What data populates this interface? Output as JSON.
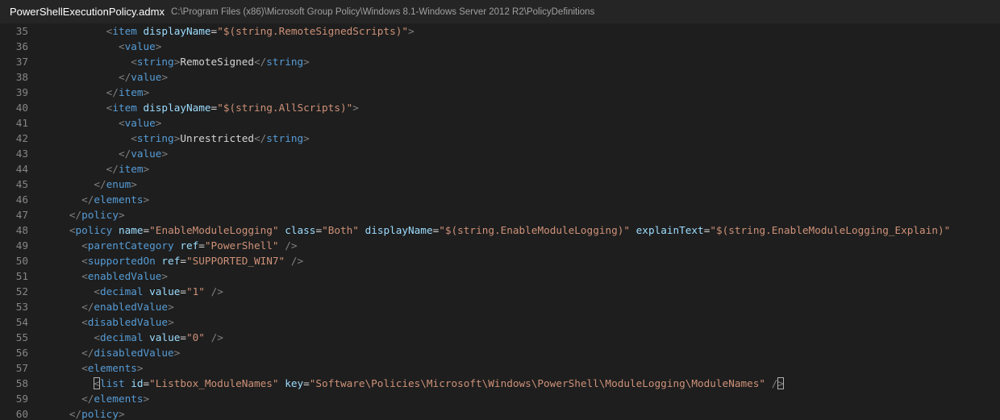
{
  "titlebar": {
    "file_name": "PowerShellExecutionPolicy.admx",
    "file_path": "C:\\Program Files (x86)\\Microsoft Group Policy\\Windows 8.1-Windows Server 2012 R2\\PolicyDefinitions"
  },
  "colors": {
    "background": "#1e1e1e",
    "titlebar": "#252526",
    "line_number": "#858585",
    "punctuation": "#808080",
    "tag": "#569cd6",
    "attribute": "#9cdcfe",
    "string": "#ce9178",
    "text": "#d4d4d4"
  },
  "lines": [
    {
      "n": "35",
      "indent": "            ",
      "tokens": [
        [
          "p",
          "<"
        ],
        [
          "t",
          "item"
        ],
        [
          "x",
          " "
        ],
        [
          "a",
          "displayName"
        ],
        [
          "e",
          "="
        ],
        [
          "s",
          "\"$(string.RemoteSignedScripts)\""
        ],
        [
          "p",
          ">"
        ]
      ]
    },
    {
      "n": "36",
      "indent": "              ",
      "tokens": [
        [
          "p",
          "<"
        ],
        [
          "t",
          "value"
        ],
        [
          "p",
          ">"
        ]
      ]
    },
    {
      "n": "37",
      "indent": "                ",
      "tokens": [
        [
          "p",
          "<"
        ],
        [
          "t",
          "string"
        ],
        [
          "p",
          ">"
        ],
        [
          "x",
          "RemoteSigned"
        ],
        [
          "p",
          "</"
        ],
        [
          "t",
          "string"
        ],
        [
          "p",
          ">"
        ]
      ]
    },
    {
      "n": "38",
      "indent": "              ",
      "tokens": [
        [
          "p",
          "</"
        ],
        [
          "t",
          "value"
        ],
        [
          "p",
          ">"
        ]
      ]
    },
    {
      "n": "39",
      "indent": "            ",
      "tokens": [
        [
          "p",
          "</"
        ],
        [
          "t",
          "item"
        ],
        [
          "p",
          ">"
        ]
      ]
    },
    {
      "n": "40",
      "indent": "            ",
      "tokens": [
        [
          "p",
          "<"
        ],
        [
          "t",
          "item"
        ],
        [
          "x",
          " "
        ],
        [
          "a",
          "displayName"
        ],
        [
          "e",
          "="
        ],
        [
          "s",
          "\"$(string.AllScripts)\""
        ],
        [
          "p",
          ">"
        ]
      ]
    },
    {
      "n": "41",
      "indent": "              ",
      "tokens": [
        [
          "p",
          "<"
        ],
        [
          "t",
          "value"
        ],
        [
          "p",
          ">"
        ]
      ]
    },
    {
      "n": "42",
      "indent": "                ",
      "tokens": [
        [
          "p",
          "<"
        ],
        [
          "t",
          "string"
        ],
        [
          "p",
          ">"
        ],
        [
          "x",
          "Unrestricted"
        ],
        [
          "p",
          "</"
        ],
        [
          "t",
          "string"
        ],
        [
          "p",
          ">"
        ]
      ]
    },
    {
      "n": "43",
      "indent": "              ",
      "tokens": [
        [
          "p",
          "</"
        ],
        [
          "t",
          "value"
        ],
        [
          "p",
          ">"
        ]
      ]
    },
    {
      "n": "44",
      "indent": "            ",
      "tokens": [
        [
          "p",
          "</"
        ],
        [
          "t",
          "item"
        ],
        [
          "p",
          ">"
        ]
      ]
    },
    {
      "n": "45",
      "indent": "          ",
      "tokens": [
        [
          "p",
          "</"
        ],
        [
          "t",
          "enum"
        ],
        [
          "p",
          ">"
        ]
      ]
    },
    {
      "n": "46",
      "indent": "        ",
      "tokens": [
        [
          "p",
          "</"
        ],
        [
          "t",
          "elements"
        ],
        [
          "p",
          ">"
        ]
      ]
    },
    {
      "n": "47",
      "indent": "      ",
      "tokens": [
        [
          "p",
          "</"
        ],
        [
          "t",
          "policy"
        ],
        [
          "p",
          ">"
        ]
      ]
    },
    {
      "n": "48",
      "indent": "      ",
      "tokens": [
        [
          "p",
          "<"
        ],
        [
          "t",
          "policy"
        ],
        [
          "x",
          " "
        ],
        [
          "a",
          "name"
        ],
        [
          "e",
          "="
        ],
        [
          "s",
          "\"EnableModuleLogging\""
        ],
        [
          "x",
          " "
        ],
        [
          "a",
          "class"
        ],
        [
          "e",
          "="
        ],
        [
          "s",
          "\"Both\""
        ],
        [
          "x",
          " "
        ],
        [
          "a",
          "displayName"
        ],
        [
          "e",
          "="
        ],
        [
          "s",
          "\"$(string.EnableModuleLogging)\""
        ],
        [
          "x",
          " "
        ],
        [
          "a",
          "explainText"
        ],
        [
          "e",
          "="
        ],
        [
          "s",
          "\"$(string.EnableModuleLogging_Explain)\""
        ]
      ]
    },
    {
      "n": "49",
      "indent": "        ",
      "tokens": [
        [
          "p",
          "<"
        ],
        [
          "t",
          "parentCategory"
        ],
        [
          "x",
          " "
        ],
        [
          "a",
          "ref"
        ],
        [
          "e",
          "="
        ],
        [
          "s",
          "\"PowerShell\""
        ],
        [
          "x",
          " "
        ],
        [
          "p",
          "/>"
        ]
      ]
    },
    {
      "n": "50",
      "indent": "        ",
      "tokens": [
        [
          "p",
          "<"
        ],
        [
          "t",
          "supportedOn"
        ],
        [
          "x",
          " "
        ],
        [
          "a",
          "ref"
        ],
        [
          "e",
          "="
        ],
        [
          "s",
          "\"SUPPORTED_WIN7\""
        ],
        [
          "x",
          " "
        ],
        [
          "p",
          "/>"
        ]
      ]
    },
    {
      "n": "51",
      "indent": "        ",
      "tokens": [
        [
          "p",
          "<"
        ],
        [
          "t",
          "enabledValue"
        ],
        [
          "p",
          ">"
        ]
      ]
    },
    {
      "n": "52",
      "indent": "          ",
      "tokens": [
        [
          "p",
          "<"
        ],
        [
          "t",
          "decimal"
        ],
        [
          "x",
          " "
        ],
        [
          "a",
          "value"
        ],
        [
          "e",
          "="
        ],
        [
          "s",
          "\"1\""
        ],
        [
          "x",
          " "
        ],
        [
          "p",
          "/>"
        ]
      ]
    },
    {
      "n": "53",
      "indent": "        ",
      "tokens": [
        [
          "p",
          "</"
        ],
        [
          "t",
          "enabledValue"
        ],
        [
          "p",
          ">"
        ]
      ]
    },
    {
      "n": "54",
      "indent": "        ",
      "tokens": [
        [
          "p",
          "<"
        ],
        [
          "t",
          "disabledValue"
        ],
        [
          "p",
          ">"
        ]
      ]
    },
    {
      "n": "55",
      "indent": "          ",
      "tokens": [
        [
          "p",
          "<"
        ],
        [
          "t",
          "decimal"
        ],
        [
          "x",
          " "
        ],
        [
          "a",
          "value"
        ],
        [
          "e",
          "="
        ],
        [
          "s",
          "\"0\""
        ],
        [
          "x",
          " "
        ],
        [
          "p",
          "/>"
        ]
      ]
    },
    {
      "n": "56",
      "indent": "        ",
      "tokens": [
        [
          "p",
          "</"
        ],
        [
          "t",
          "disabledValue"
        ],
        [
          "p",
          ">"
        ]
      ]
    },
    {
      "n": "57",
      "indent": "        ",
      "tokens": [
        [
          "p",
          "<"
        ],
        [
          "t",
          "elements"
        ],
        [
          "p",
          ">"
        ]
      ]
    },
    {
      "n": "58",
      "indent": "          ",
      "tokens": [
        [
          "ph",
          "<"
        ],
        [
          "t",
          "list"
        ],
        [
          "x",
          " "
        ],
        [
          "a",
          "id"
        ],
        [
          "e",
          "="
        ],
        [
          "s",
          "\"Listbox_ModuleNames\""
        ],
        [
          "x",
          " "
        ],
        [
          "a",
          "key"
        ],
        [
          "e",
          "="
        ],
        [
          "s",
          "\"Software\\Policies\\Microsoft\\Windows\\PowerShell\\ModuleLogging\\ModuleNames\""
        ],
        [
          "x",
          " "
        ],
        [
          "p",
          "/"
        ],
        [
          "ph",
          ">"
        ]
      ]
    },
    {
      "n": "59",
      "indent": "        ",
      "tokens": [
        [
          "p",
          "</"
        ],
        [
          "t",
          "elements"
        ],
        [
          "p",
          ">"
        ]
      ]
    },
    {
      "n": "60",
      "indent": "      ",
      "tokens": [
        [
          "p",
          "</"
        ],
        [
          "t",
          "policy"
        ],
        [
          "p",
          ">"
        ]
      ]
    }
  ]
}
